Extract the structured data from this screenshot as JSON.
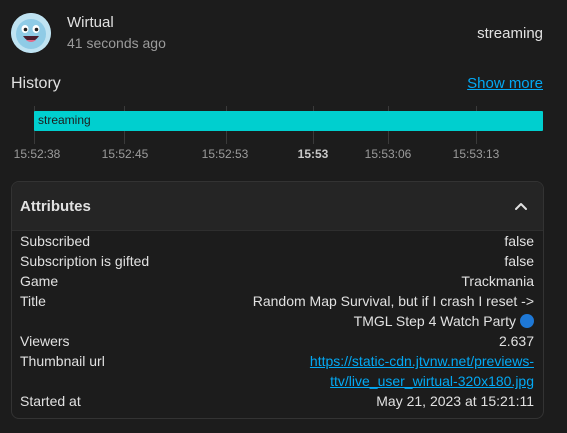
{
  "entity": {
    "name": "Wirtual",
    "last_changed": "41 seconds ago",
    "state": "streaming"
  },
  "history": {
    "title": "History",
    "show_more": "Show more",
    "bar_label": "streaming",
    "ticks": [
      "15:52:38",
      "15:52:45",
      "15:52:53",
      "15:53",
      "15:53:06",
      "15:53:13"
    ]
  },
  "attributes": {
    "title": "Attributes",
    "rows": [
      {
        "key": "Subscribed",
        "value": "false"
      },
      {
        "key": "Subscription is gifted",
        "value": "false"
      },
      {
        "key": "Game",
        "value": "Trackmania"
      },
      {
        "key": "Title",
        "value_line1": "Random Map Survival, but if I crash I reset ->",
        "value_line2": "TMGL Step 4 Watch Party"
      },
      {
        "key": "Viewers",
        "value": "2.637"
      },
      {
        "key": "Thumbnail url",
        "value_line1": "https://static-cdn.jtvnw.net/previews-",
        "value_line2": "ttv/live_user_wirtual-320x180.jpg"
      },
      {
        "key": "Started at",
        "value": "May 21, 2023 at 15:21:11"
      }
    ]
  }
}
